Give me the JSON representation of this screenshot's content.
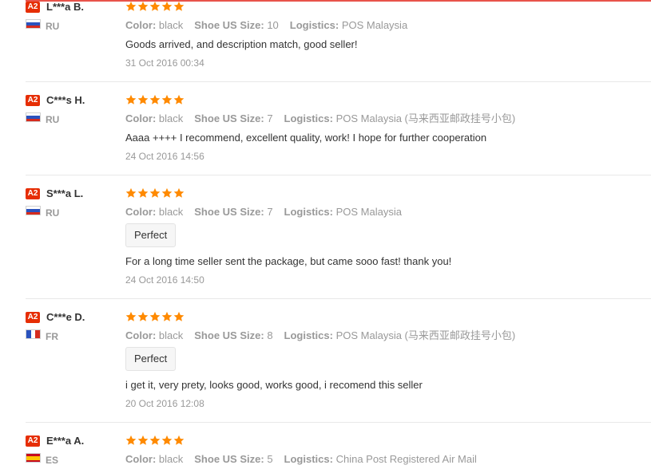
{
  "reviews": [
    {
      "level": "A2",
      "name": "L***a B.",
      "country": "RU",
      "flag": "russia",
      "rating": 5,
      "color_label": "Color:",
      "color_value": "black",
      "size_label": "Shoe US Size:",
      "size_value": "10",
      "logistics_label": "Logistics:",
      "logistics_value": "POS Malaysia",
      "tag": "",
      "content": "Goods arrived, and description match, good seller!",
      "date": "31 Oct 2016 00:34"
    },
    {
      "level": "A2",
      "name": "C***s H.",
      "country": "RU",
      "flag": "russia",
      "rating": 5,
      "color_label": "Color:",
      "color_value": "black",
      "size_label": "Shoe US Size:",
      "size_value": "7",
      "logistics_label": "Logistics:",
      "logistics_value": "POS Malaysia (马来西亚邮政挂号小包)",
      "tag": "",
      "content": "Aaaa ++++ I recommend, excellent quality, work! I hope for further cooperation",
      "date": "24 Oct 2016 14:56"
    },
    {
      "level": "A2",
      "name": "S***a L.",
      "country": "RU",
      "flag": "russia",
      "rating": 5,
      "color_label": "Color:",
      "color_value": "black",
      "size_label": "Shoe US Size:",
      "size_value": "7",
      "logistics_label": "Logistics:",
      "logistics_value": "POS Malaysia",
      "tag": "Perfect",
      "content": "For a long time seller sent the package, but came sooo fast! thank you!",
      "date": "24 Oct 2016 14:50"
    },
    {
      "level": "A2",
      "name": "C***e D.",
      "country": "FR",
      "flag": "france",
      "rating": 5,
      "color_label": "Color:",
      "color_value": "black",
      "size_label": "Shoe US Size:",
      "size_value": "8",
      "logistics_label": "Logistics:",
      "logistics_value": "POS Malaysia (马来西亚邮政挂号小包)",
      "tag": "Perfect",
      "content": "i get it, very prety, looks good, works good, i recomend this seller",
      "date": "20 Oct 2016 12:08"
    },
    {
      "level": "A2",
      "name": "E***a A.",
      "country": "ES",
      "flag": "spain",
      "rating": 5,
      "color_label": "Color:",
      "color_value": "black",
      "size_label": "Shoe US Size:",
      "size_value": "5",
      "logistics_label": "Logistics:",
      "logistics_value": "China Post Registered Air Mail",
      "tag": "",
      "content": "",
      "date": ""
    }
  ],
  "colors": {
    "star": "#ff8a00",
    "badge": "#e62e04",
    "accent_line": "#e8534a"
  }
}
